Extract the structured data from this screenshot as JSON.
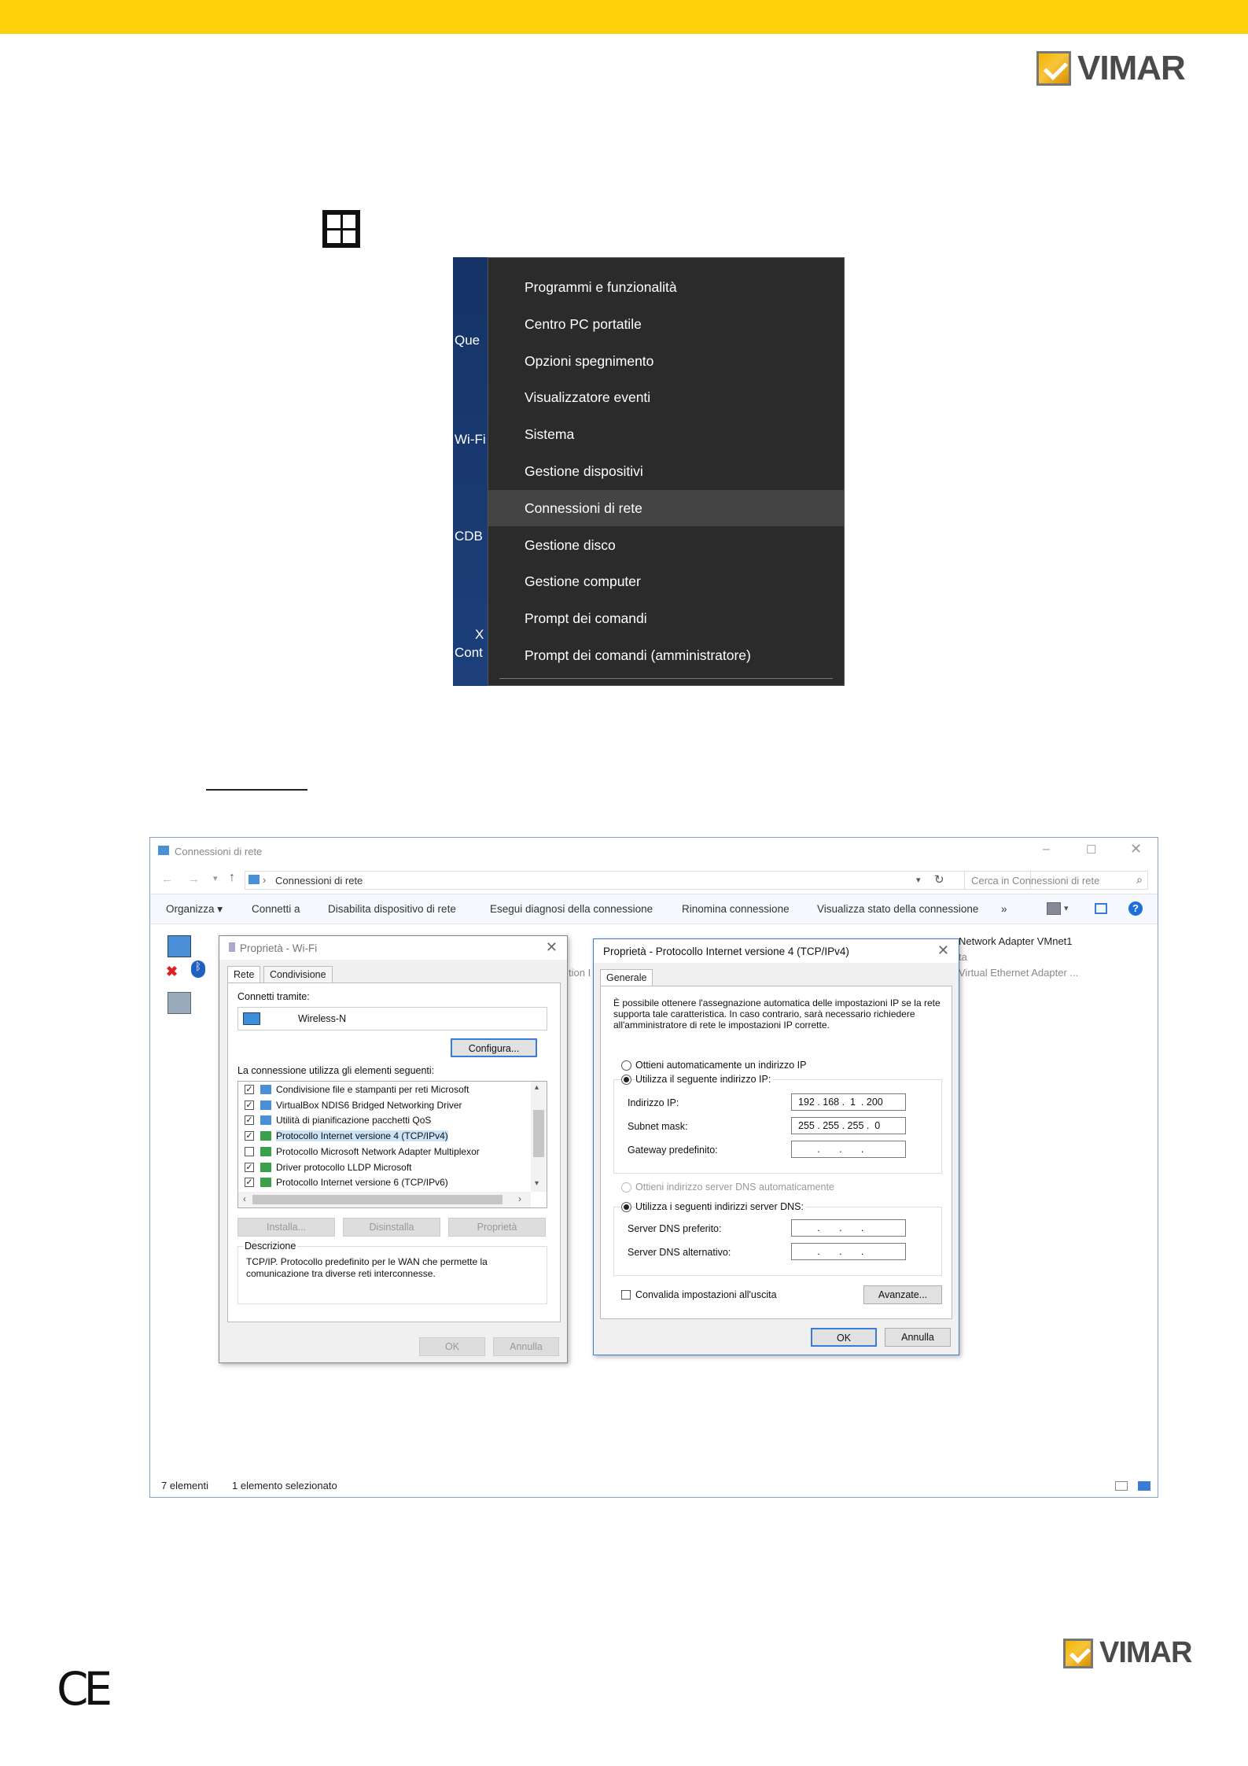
{
  "brand": {
    "name": "VIMAR",
    "accent": "#fcd10a"
  },
  "context_menu": {
    "desktop_labels": [
      "Que",
      "Wi-Fi",
      "CDB",
      "X",
      "Cont"
    ],
    "items": [
      "Programmi e funzionalità",
      "Centro PC portatile",
      "Opzioni spegnimento",
      "Visualizzatore eventi",
      "Sistema",
      "Gestione dispositivi",
      "Connessioni di rete",
      "Gestione disco",
      "Gestione computer",
      "Prompt dei comandi",
      "Prompt dei comandi (amministratore)"
    ],
    "highlighted": "Connessioni di rete"
  },
  "explorer": {
    "title": "Connessioni di rete",
    "breadcrumb": "Connessioni di rete",
    "search_placeholder": "Cerca in Connessioni di rete",
    "commands": [
      "Organizza ▾",
      "Connetti a",
      "Disabilita dispositivo di rete",
      "Esegui diagnosi della connessione",
      "Rinomina connessione",
      "Visualizza stato della connessione",
      "»"
    ],
    "bg_items": {
      "adapter1": "Network Adapter VMnet1",
      "adapter2": "Virtual Ethernet Adapter ...",
      "partial": "tion I",
      "partial2": "ta"
    },
    "status": {
      "count": "7 elementi",
      "selected": "1 elemento selezionato"
    }
  },
  "wifi_dialog": {
    "title": "Proprietà - Wi-Fi",
    "tabs": [
      "Rete",
      "Condivisione"
    ],
    "connect_using_label": "Connetti tramite:",
    "adapter": "Wireless-N",
    "configure_button": "Configura...",
    "items_label": "La connessione utilizza gli elementi seguenti:",
    "items": [
      {
        "label": "Condivisione file e stampanti per reti Microsoft",
        "checked": true
      },
      {
        "label": "VirtualBox NDIS6 Bridged Networking Driver",
        "checked": true
      },
      {
        "label": "Utilità di pianificazione pacchetti QoS",
        "checked": true
      },
      {
        "label": "Protocollo Internet versione 4 (TCP/IPv4)",
        "checked": true
      },
      {
        "label": "Protocollo Microsoft Network Adapter Multiplexor",
        "checked": false
      },
      {
        "label": "Driver protocollo LLDP Microsoft",
        "checked": true
      },
      {
        "label": "Protocollo Internet versione 6 (TCP/IPv6)",
        "checked": true
      }
    ],
    "buttons": {
      "install": "Installa...",
      "uninstall": "Disinstalla",
      "properties": "Proprietà",
      "ok": "OK",
      "cancel": "Annulla"
    },
    "description_label": "Descrizione",
    "description": "TCP/IP. Protocollo predefinito per le WAN che permette la comunicazione tra diverse reti interconnesse."
  },
  "ipv4_dialog": {
    "title": "Proprietà - Protocollo Internet versione 4 (TCP/IPv4)",
    "tab": "Generale",
    "intro": "È possibile ottenere l'assegnazione automatica delle impostazioni IP se la rete supporta tale caratteristica. In caso contrario, sarà necessario richiedere all'amministratore di rete le impostazioni IP corrette.",
    "auto_ip": "Ottieni automaticamente un indirizzo IP",
    "manual_ip": "Utilizza il seguente indirizzo IP:",
    "ip_label": "Indirizzo IP:",
    "ip_value": "192 . 168 .  1  . 200",
    "mask_label": "Subnet mask:",
    "mask_value": "255 . 255 . 255 .  0",
    "gw_label": "Gateway predefinito:",
    "gw_value": "       .       .       .",
    "auto_dns": "Ottieni indirizzo server DNS automaticamente",
    "manual_dns": "Utilizza i seguenti indirizzi server DNS:",
    "dns1_label": "Server DNS preferito:",
    "dns2_label": "Server DNS alternativo:",
    "dns_empty": "       .       .       .",
    "validate": "Convalida impostazioni all'uscita",
    "advanced": "Avanzate...",
    "ok": "OK",
    "cancel": "Annulla"
  },
  "footer": {
    "ce": "CE"
  }
}
